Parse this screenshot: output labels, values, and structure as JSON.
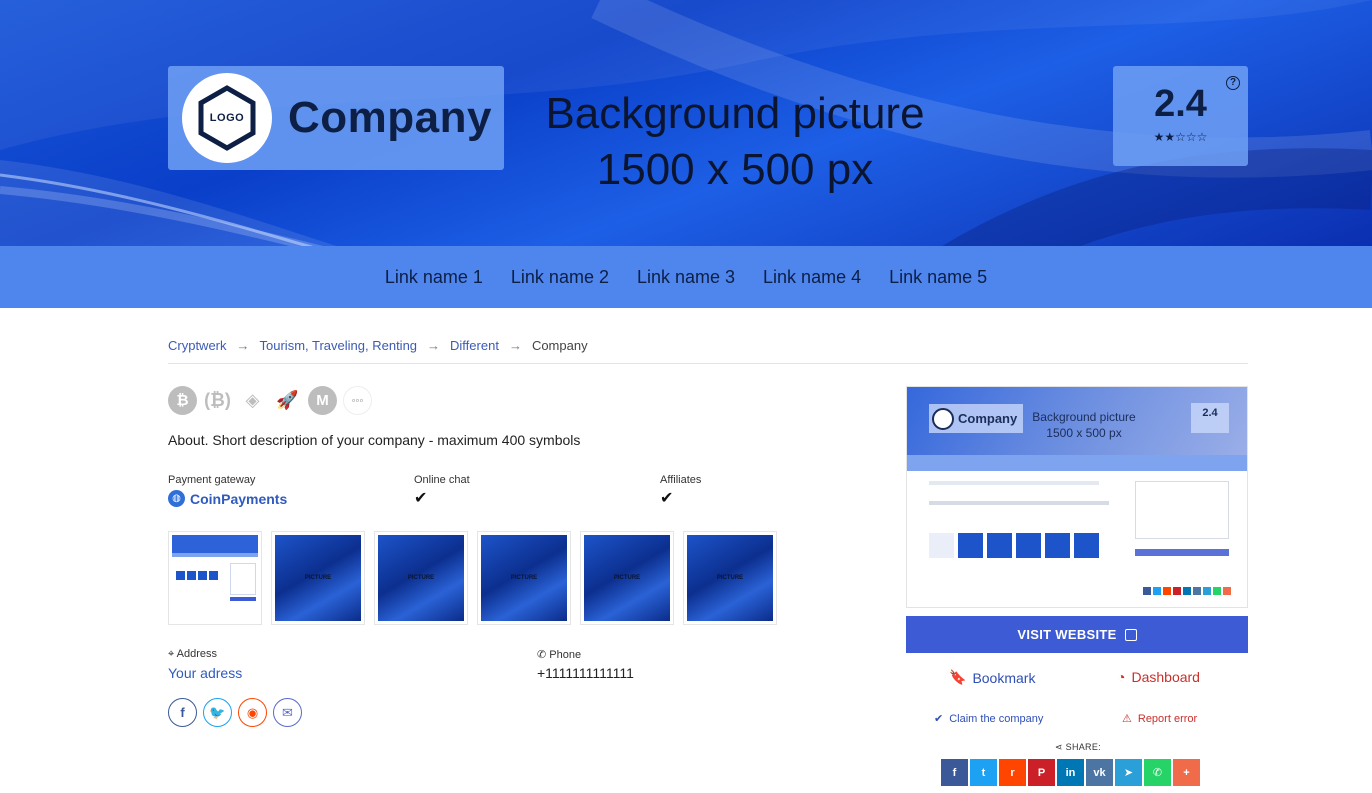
{
  "header": {
    "company_name": "Company",
    "logo_text": "LOGO",
    "background_text_line1": "Background picture",
    "background_text_line2": "1500 x 500 px",
    "rating_score": "2.4",
    "rating_value": 2.4,
    "rating_stars_display": "★★☆☆☆",
    "help_symbol": "?"
  },
  "nav": {
    "links": [
      "Link name 1",
      "Link name 2",
      "Link name 3",
      "Link name 4",
      "Link name 5"
    ]
  },
  "breadcrumb": {
    "items": [
      "Cryptwerk",
      "Tourism, Traveling, Renting",
      "Different",
      "Company"
    ]
  },
  "coins": [
    "bitcoin-icon",
    "bitcoin-cash-icon",
    "binance-icon",
    "rocket-icon",
    "monero-icon",
    "more-icon"
  ],
  "about": "About. Short description of your company - maximum 400 symbols",
  "features": {
    "payment_gateway_label": "Payment gateway",
    "payment_gateway_value": "CoinPayments",
    "online_chat_label": "Online chat",
    "affiliates_label": "Affiliates"
  },
  "gallery": {
    "picture_label": "PICTURE"
  },
  "contact": {
    "address_label": "Address",
    "address_value": "Your adress",
    "phone_label": "Phone",
    "phone_value": "+1111111111111"
  },
  "social": [
    "facebook-icon",
    "twitter-icon",
    "reddit-icon",
    "email-icon"
  ],
  "preview": {
    "company_name": "Company",
    "bg_line1": "Background picture",
    "bg_line2": "1500 x 500 px",
    "rating": "2.4"
  },
  "actions": {
    "visit_website": "VISIT WEBSITE",
    "bookmark": "Bookmark",
    "dashboard": "Dashboard",
    "claim": "Claim the company",
    "report": "Report error",
    "share_label": "SHARE:"
  },
  "colors": {
    "hero_blue": "#0a3fc9",
    "nav_blue": "#4f86ee",
    "link_blue": "#2f5bbf",
    "visit_button": "#3d5bd4",
    "danger_red": "#c9302c"
  },
  "share_buttons": [
    {
      "icon": "facebook-icon",
      "color": "#3b5998"
    },
    {
      "icon": "twitter-icon",
      "color": "#1da1f2"
    },
    {
      "icon": "reddit-icon",
      "color": "#ff4500"
    },
    {
      "icon": "pinterest-icon",
      "color": "#cb2027"
    },
    {
      "icon": "linkedin-icon",
      "color": "#0077b5"
    },
    {
      "icon": "vk-icon",
      "color": "#4c75a3"
    },
    {
      "icon": "telegram-icon",
      "color": "#2a9fd8"
    },
    {
      "icon": "whatsapp-icon",
      "color": "#25d366"
    },
    {
      "icon": "more-share-icon",
      "color": "#f06b4a"
    }
  ]
}
